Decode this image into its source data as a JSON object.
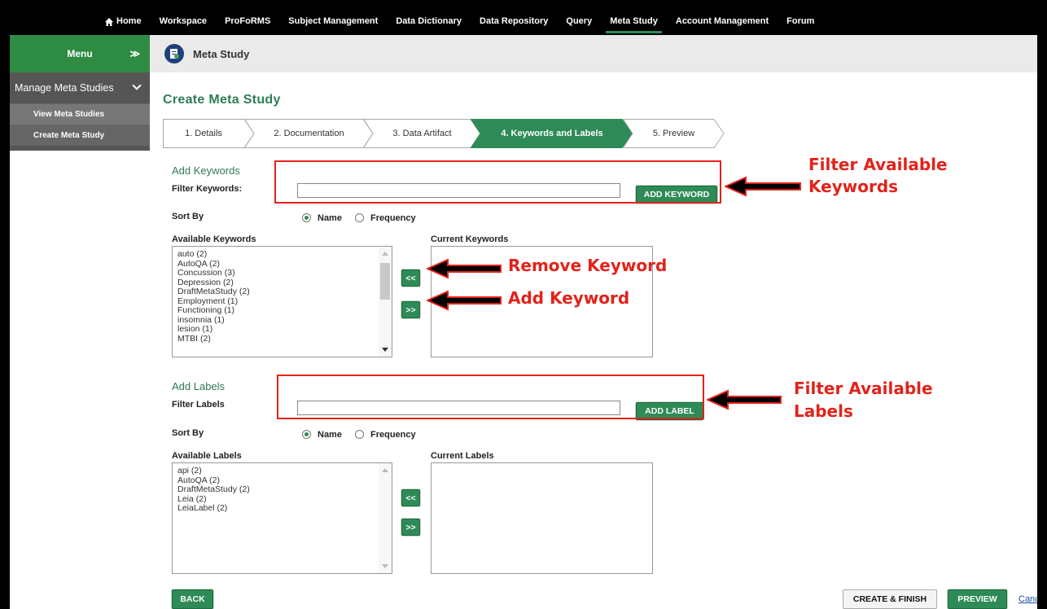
{
  "nav": {
    "items": [
      "Home",
      "Workspace",
      "ProFoRMS",
      "Subject Management",
      "Data Dictionary",
      "Data Repository",
      "Query",
      "Meta Study",
      "Account Management",
      "Forum"
    ],
    "active": "Meta Study"
  },
  "sidebar": {
    "menu_label": "Menu",
    "section_label": "Manage Meta Studies",
    "items": [
      "View Meta Studies",
      "Create Meta Study"
    ]
  },
  "page_header": {
    "title": "Meta Study"
  },
  "main": {
    "heading": "Create Meta Study",
    "steps": [
      "1. Details",
      "2. Documentation",
      "3. Data Artifact",
      "4. Keywords and Labels",
      "5. Preview"
    ],
    "active_step_index": 3,
    "keywords": {
      "section_title": "Add Keywords",
      "filter_label": "Filter Keywords:",
      "filter_value": "",
      "add_button": "ADD KEYWORD",
      "sort_by_label": "Sort By",
      "sort_options": [
        "Name",
        "Frequency"
      ],
      "sort_selected": "Name",
      "available_label": "Available Keywords",
      "current_label": "Current Keywords",
      "available": [
        "auto (2)",
        "AutoQA (2)",
        "Concussion (3)",
        "Depression (2)",
        "DraftMetaStudy (2)",
        "Employment (1)",
        "Functioning (1)",
        "insomnia (1)",
        "lesion (1)",
        "MTBI (2)"
      ],
      "current": [],
      "remove_button": "<<",
      "add_move_button": ">>"
    },
    "labels": {
      "section_title": "Add Labels",
      "filter_label": "Filter Labels",
      "filter_value": "",
      "add_button": "ADD LABEL",
      "sort_by_label": "Sort By",
      "sort_options": [
        "Name",
        "Frequency"
      ],
      "sort_selected": "Name",
      "available_label": "Available Labels",
      "current_label": "Current Labels",
      "available": [
        "api (2)",
        "AutoQA (2)",
        "DraftMetaStudy (2)",
        "Leia (2)",
        "LeiaLabel (2)"
      ],
      "current": [],
      "remove_button": "<<",
      "add_move_button": ">>"
    },
    "footer": {
      "back": "BACK",
      "create_finish": "CREATE & FINISH",
      "preview": "PREVIEW",
      "cancel": "Cancel"
    }
  },
  "annotations": {
    "filter_keywords": [
      "Filter Available",
      "Keywords"
    ],
    "remove_keyword": "Remove Keyword",
    "add_keyword": "Add Keyword",
    "filter_labels": [
      "Filter Available",
      "Labels"
    ]
  },
  "colors": {
    "brand_green": "#2e8b43",
    "button_green": "#2e8b57",
    "annotation_red": "#e2231a",
    "nav_bg": "#000000"
  }
}
